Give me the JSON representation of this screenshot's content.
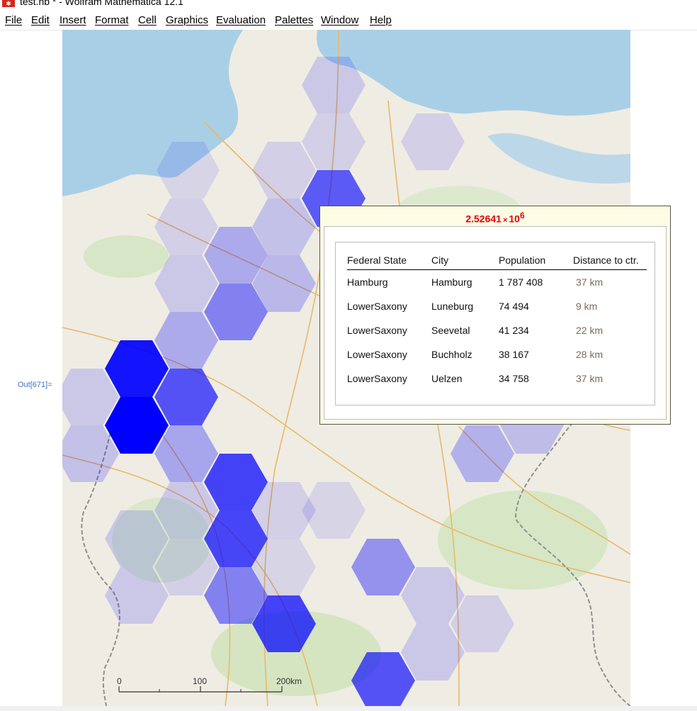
{
  "window": {
    "title": "test.nb * - Wolfram Mathematica 12.1",
    "brand_color": "#d9261c"
  },
  "menu": [
    {
      "label": "File"
    },
    {
      "label": "Edit"
    },
    {
      "label": "Insert"
    },
    {
      "label": "Format"
    },
    {
      "label": "Cell"
    },
    {
      "label": "Graphics"
    },
    {
      "label": "Evaluation"
    },
    {
      "label": "Palettes"
    },
    {
      "label": "Window"
    },
    {
      "label": "Help"
    }
  ],
  "cell": {
    "label": "Out[671]="
  },
  "map": {
    "hex_color": "#0000ff",
    "scale_bar": {
      "labels": [
        "0",
        "100",
        "200km"
      ]
    }
  },
  "tooltip": {
    "value_mantissa": "2.52641",
    "value_times": "×",
    "value_base": "10",
    "value_exponent": "6",
    "value_color": "#e60000",
    "table": {
      "headers": [
        "Federal State",
        "City",
        "Population",
        "Distance to ctr."
      ],
      "rows": [
        [
          "Hamburg",
          "Hamburg",
          "1 787 408",
          "37 km"
        ],
        [
          "LowerSaxony",
          "Luneburg",
          "74 494",
          "9 km"
        ],
        [
          "LowerSaxony",
          "Seevetal",
          "41 234",
          "22 km"
        ],
        [
          "LowerSaxony",
          "Buchholz",
          "38 167",
          "28 km"
        ],
        [
          "LowerSaxony",
          "Uelzen",
          "34 758",
          "37 km"
        ]
      ]
    }
  }
}
